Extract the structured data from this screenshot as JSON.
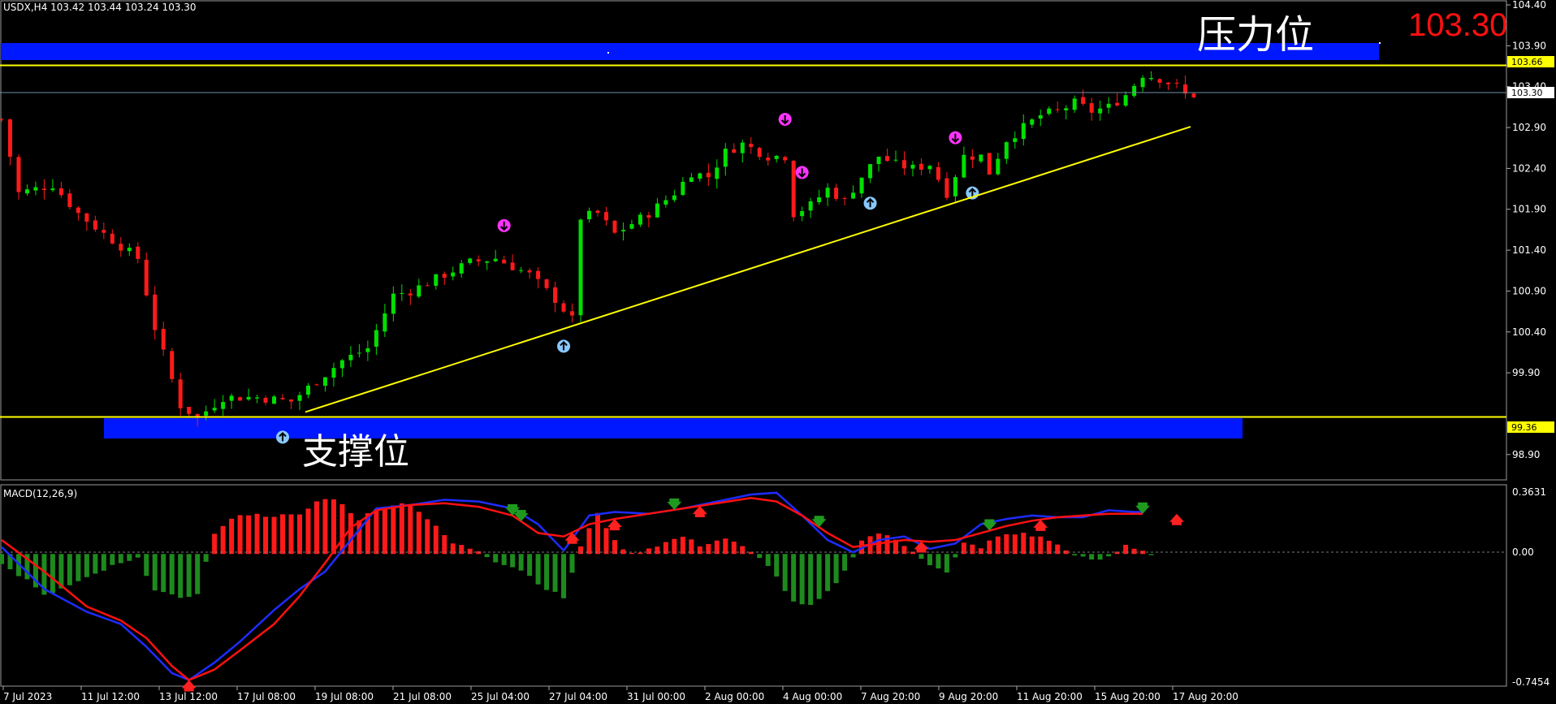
{
  "header": {
    "symbol_info": "USDX,H4  103.42 103.44 103.24 103.30"
  },
  "current_price_big": "103.30",
  "zones": {
    "resistance_label": "压力位",
    "support_label": "支撑位",
    "resistance_value": "103.66",
    "support_value": "99.36",
    "current_tag": "103.30"
  },
  "macd": {
    "label": "MACD(12,26,9)",
    "max_label": "0.3631",
    "zero_label": "0.00",
    "min_label": "-0.7454"
  },
  "colors": {
    "bull": "#00e000",
    "bear": "#ff1a1a",
    "zone": "#0018ff",
    "level": "#ffff00",
    "macd_line": "#1e2cff",
    "signal_line": "#ff1010",
    "hist_pos": "#ff1a1a",
    "hist_neg": "#1e8a1e",
    "big_price": "#ff1010",
    "fractal_up": "#ff33ff",
    "fractal_down": "#88c8ff"
  },
  "chart_data": [
    {
      "type": "candlestick",
      "title": "USDX,H4",
      "ylim": [
        98.6,
        104.44
      ],
      "y_ticks": [
        "104.40",
        "103.90",
        "103.40",
        "102.90",
        "102.40",
        "101.90",
        "101.40",
        "100.90",
        "100.40",
        "99.90",
        "98.90"
      ],
      "x_tick_labels": [
        "7 Jul 2023",
        "11 Jul 12:00",
        "13 Jul 12:00",
        "17 Jul 08:00",
        "19 Jul 08:00",
        "21 Jul 08:00",
        "25 Jul 04:00",
        "27 Jul 04:00",
        "31 Jul 00:00",
        "2 Aug 00:00",
        "4 Aug 00:00",
        "7 Aug 20:00",
        "9 Aug 20:00",
        "11 Aug 20:00",
        "15 Aug 20:00",
        "17 Aug 20:00"
      ],
      "levels": {
        "resistance": 103.66,
        "support": 99.36,
        "last": 103.3
      },
      "trendline": {
        "from": 99.42,
        "to": 102.91
      },
      "close_path": [
        [
          0,
          103.0
        ],
        [
          2,
          102.1
        ],
        [
          6,
          102.2
        ],
        [
          9,
          101.85
        ],
        [
          12,
          101.6
        ],
        [
          16,
          101.3
        ],
        [
          18,
          100.45
        ],
        [
          21,
          99.5
        ],
        [
          23,
          99.35
        ],
        [
          26,
          99.6
        ],
        [
          30,
          99.6
        ],
        [
          34,
          99.55
        ],
        [
          37,
          99.8
        ],
        [
          40,
          100.05
        ],
        [
          43,
          100.2
        ],
        [
          46,
          100.85
        ],
        [
          48,
          100.9
        ],
        [
          51,
          101.05
        ],
        [
          55,
          101.25
        ],
        [
          58,
          101.3
        ],
        [
          62,
          101.1
        ],
        [
          65,
          100.8
        ],
        [
          67,
          100.55
        ],
        [
          68,
          101.8
        ],
        [
          70,
          101.85
        ],
        [
          72,
          101.6
        ],
        [
          76,
          101.85
        ],
        [
          79,
          102.1
        ],
        [
          81,
          102.35
        ],
        [
          83,
          102.3
        ],
        [
          85,
          102.6
        ],
        [
          87,
          102.7
        ],
        [
          90,
          102.55
        ],
        [
          92,
          102.55
        ],
        [
          93,
          101.85
        ],
        [
          95,
          101.95
        ],
        [
          97,
          102.15
        ],
        [
          99,
          102.0
        ],
        [
          101,
          102.3
        ],
        [
          103,
          102.55
        ],
        [
          105,
          102.45
        ],
        [
          107,
          102.4
        ],
        [
          109,
          102.45
        ],
        [
          111,
          102.1
        ],
        [
          113,
          102.55
        ],
        [
          115,
          102.55
        ],
        [
          116,
          102.35
        ],
        [
          118,
          102.75
        ],
        [
          120,
          102.9
        ],
        [
          122,
          103.05
        ],
        [
          124,
          103.1
        ],
        [
          126,
          103.2
        ],
        [
          128,
          103.1
        ],
        [
          130,
          103.15
        ],
        [
          132,
          103.3
        ],
        [
          134,
          103.55
        ],
        [
          136,
          103.5
        ],
        [
          138,
          103.4
        ],
        [
          139,
          103.3
        ]
      ],
      "fractals": [
        {
          "bar": 59,
          "dir": "up"
        },
        {
          "bar": 92,
          "dir": "up"
        },
        {
          "bar": 94,
          "dir": "up"
        },
        {
          "bar": 112,
          "dir": "up"
        },
        {
          "bar": 66,
          "dir": "down"
        },
        {
          "bar": 102,
          "dir": "down"
        },
        {
          "bar": 114,
          "dir": "down"
        },
        {
          "bar": 33,
          "dir": "down"
        }
      ]
    },
    {
      "type": "macd",
      "title": "MACD(12,26,9)",
      "ylim": [
        -0.7454,
        0.3631
      ],
      "histogram": [
        [
          0,
          -0.06
        ],
        [
          3,
          -0.15
        ],
        [
          5,
          -0.24
        ],
        [
          7,
          -0.2
        ],
        [
          10,
          -0.14
        ],
        [
          13,
          -0.07
        ],
        [
          16,
          -0.03
        ],
        [
          18,
          -0.2
        ],
        [
          21,
          -0.26
        ],
        [
          23,
          -0.22
        ],
        [
          25,
          0.12
        ],
        [
          28,
          0.23
        ],
        [
          31,
          0.22
        ],
        [
          35,
          0.22
        ],
        [
          37,
          0.3
        ],
        [
          39,
          0.32
        ],
        [
          42,
          0.2
        ],
        [
          45,
          0.28
        ],
        [
          48,
          0.29
        ],
        [
          50,
          0.2
        ],
        [
          53,
          0.06
        ],
        [
          56,
          0.02
        ],
        [
          58,
          -0.04
        ],
        [
          61,
          -0.09
        ],
        [
          64,
          -0.2
        ],
        [
          66,
          -0.25
        ],
        [
          68,
          0.04
        ],
        [
          70,
          0.24
        ],
        [
          72,
          0.07
        ],
        [
          74,
          0.0
        ],
        [
          77,
          0.05
        ],
        [
          80,
          0.1
        ],
        [
          82,
          0.05
        ],
        [
          85,
          0.09
        ],
        [
          87,
          0.04
        ],
        [
          90,
          -0.06
        ],
        [
          93,
          -0.28
        ],
        [
          95,
          -0.3
        ],
        [
          97,
          -0.22
        ],
        [
          99,
          -0.1
        ],
        [
          101,
          0.08
        ],
        [
          103,
          0.12
        ],
        [
          105,
          0.08
        ],
        [
          107,
          0.02
        ],
        [
          109,
          -0.06
        ],
        [
          111,
          -0.11
        ],
        [
          113,
          0.06
        ],
        [
          115,
          0.04
        ],
        [
          117,
          0.1
        ],
        [
          120,
          0.12
        ],
        [
          123,
          0.08
        ],
        [
          125,
          0.02
        ],
        [
          128,
          -0.04
        ],
        [
          130,
          -0.02
        ],
        [
          132,
          0.05
        ],
        [
          134,
          0.02
        ],
        [
          135,
          0.0
        ]
      ],
      "macd_line": [
        [
          0,
          0.04
        ],
        [
          5,
          -0.2
        ],
        [
          10,
          -0.33
        ],
        [
          14,
          -0.4
        ],
        [
          17,
          -0.53
        ],
        [
          20,
          -0.68
        ],
        [
          22,
          -0.72
        ],
        [
          25,
          -0.62
        ],
        [
          28,
          -0.5
        ],
        [
          32,
          -0.32
        ],
        [
          35,
          -0.2
        ],
        [
          38,
          -0.1
        ],
        [
          41,
          0.08
        ],
        [
          44,
          0.26
        ],
        [
          48,
          0.28
        ],
        [
          52,
          0.31
        ],
        [
          56,
          0.3
        ],
        [
          60,
          0.26
        ],
        [
          63,
          0.17
        ],
        [
          66,
          0.02
        ],
        [
          69,
          0.22
        ],
        [
          72,
          0.24
        ],
        [
          76,
          0.23
        ],
        [
          80,
          0.26
        ],
        [
          84,
          0.3
        ],
        [
          88,
          0.34
        ],
        [
          91,
          0.35
        ],
        [
          94,
          0.22
        ],
        [
          97,
          0.08
        ],
        [
          100,
          0.01
        ],
        [
          103,
          0.08
        ],
        [
          106,
          0.1
        ],
        [
          109,
          0.03
        ],
        [
          112,
          0.06
        ],
        [
          115,
          0.17
        ],
        [
          118,
          0.2
        ],
        [
          121,
          0.22
        ],
        [
          124,
          0.21
        ],
        [
          127,
          0.21
        ],
        [
          130,
          0.25
        ],
        [
          133,
          0.24
        ],
        [
          134,
          0.24
        ]
      ],
      "signal_line": [
        [
          0,
          0.08
        ],
        [
          5,
          -0.1
        ],
        [
          10,
          -0.3
        ],
        [
          14,
          -0.38
        ],
        [
          17,
          -0.48
        ],
        [
          20,
          -0.64
        ],
        [
          22,
          -0.72
        ],
        [
          25,
          -0.66
        ],
        [
          28,
          -0.55
        ],
        [
          32,
          -0.4
        ],
        [
          35,
          -0.24
        ],
        [
          38,
          -0.05
        ],
        [
          41,
          0.15
        ],
        [
          44,
          0.25
        ],
        [
          48,
          0.28
        ],
        [
          52,
          0.29
        ],
        [
          56,
          0.27
        ],
        [
          60,
          0.22
        ],
        [
          63,
          0.12
        ],
        [
          66,
          0.1
        ],
        [
          69,
          0.17
        ],
        [
          72,
          0.2
        ],
        [
          76,
          0.23
        ],
        [
          80,
          0.26
        ],
        [
          84,
          0.29
        ],
        [
          88,
          0.32
        ],
        [
          91,
          0.3
        ],
        [
          94,
          0.22
        ],
        [
          97,
          0.12
        ],
        [
          100,
          0.04
        ],
        [
          103,
          0.06
        ],
        [
          106,
          0.08
        ],
        [
          109,
          0.07
        ],
        [
          112,
          0.08
        ],
        [
          115,
          0.12
        ],
        [
          118,
          0.16
        ],
        [
          121,
          0.19
        ],
        [
          124,
          0.21
        ],
        [
          127,
          0.22
        ],
        [
          130,
          0.23
        ],
        [
          133,
          0.23
        ],
        [
          134,
          0.23
        ]
      ],
      "signals": [
        {
          "bar": 22,
          "dir": "buy"
        },
        {
          "bar": 60,
          "dir": "sell"
        },
        {
          "bar": 61,
          "dir": "sell"
        },
        {
          "bar": 67,
          "dir": "buy"
        },
        {
          "bar": 72,
          "dir": "buy"
        },
        {
          "bar": 79,
          "dir": "sell"
        },
        {
          "bar": 82,
          "dir": "buy"
        },
        {
          "bar": 96,
          "dir": "sell"
        },
        {
          "bar": 108,
          "dir": "buy"
        },
        {
          "bar": 116,
          "dir": "sell"
        },
        {
          "bar": 122,
          "dir": "buy"
        },
        {
          "bar": 134,
          "dir": "sell"
        },
        {
          "bar": 138,
          "dir": "buy"
        }
      ]
    }
  ]
}
